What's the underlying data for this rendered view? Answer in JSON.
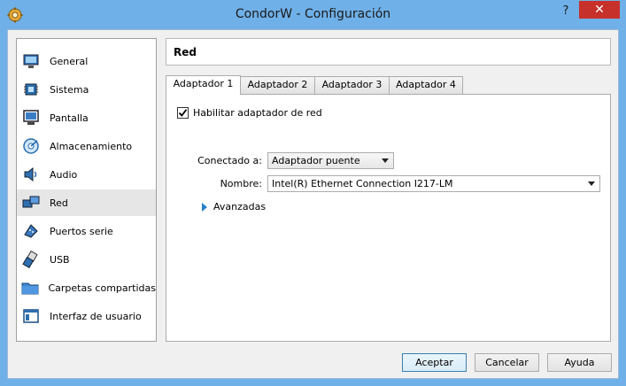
{
  "window": {
    "title": "CondorW - Configuración",
    "help_label": "?",
    "close_label": "✕"
  },
  "sidebar": {
    "items": [
      {
        "label": "General",
        "icon": "monitor-general-icon"
      },
      {
        "label": "Sistema",
        "icon": "chip-icon"
      },
      {
        "label": "Pantalla",
        "icon": "display-icon"
      },
      {
        "label": "Almacenamiento",
        "icon": "storage-icon"
      },
      {
        "label": "Audio",
        "icon": "speaker-icon"
      },
      {
        "label": "Red",
        "icon": "network-icon",
        "selected": true
      },
      {
        "label": "Puertos serie",
        "icon": "serial-port-icon"
      },
      {
        "label": "USB",
        "icon": "usb-icon"
      },
      {
        "label": "Carpetas compartidas",
        "icon": "folder-icon"
      },
      {
        "label": "Interfaz de usuario",
        "icon": "ui-window-icon"
      }
    ]
  },
  "header": {
    "title": "Red"
  },
  "tabs": [
    {
      "label": "Adaptador 1",
      "active": true
    },
    {
      "label": "Adaptador 2"
    },
    {
      "label": "Adaptador 3"
    },
    {
      "label": "Adaptador 4"
    }
  ],
  "panel": {
    "enable_label": "Habilitar adaptador de red",
    "enable_checked": true,
    "attached_label": "Conectado a:",
    "attached_value": "Adaptador puente",
    "name_label": "Nombre:",
    "name_value": "Intel(R) Ethernet Connection I217-LM",
    "advanced_label": "Avanzadas"
  },
  "buttons": {
    "ok": "Aceptar",
    "cancel": "Cancelar",
    "help": "Ayuda"
  }
}
